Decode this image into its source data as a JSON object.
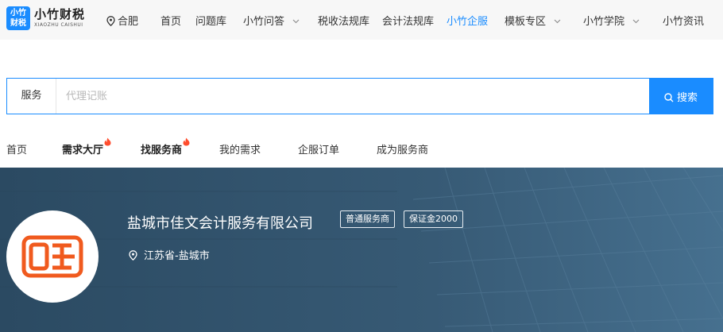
{
  "header": {
    "logo": {
      "mark_line1": "小竹",
      "mark_line2": "财税",
      "name": "小竹财税",
      "sub": "XIAOZHU CAISHUI"
    },
    "location": "合肥",
    "nav": [
      {
        "label": "首页",
        "dropdown": false,
        "active": false
      },
      {
        "label": "问题库",
        "dropdown": false,
        "active": false
      },
      {
        "label": "小竹问答",
        "dropdown": true,
        "active": false
      },
      {
        "label": "税收法规库",
        "dropdown": false,
        "active": false
      },
      {
        "label": "会计法规库",
        "dropdown": false,
        "active": false
      },
      {
        "label": "小竹企服",
        "dropdown": false,
        "active": true
      },
      {
        "label": "模板专区",
        "dropdown": true,
        "active": false
      },
      {
        "label": "小竹学院",
        "dropdown": true,
        "active": false
      },
      {
        "label": "小竹资讯",
        "dropdown": false,
        "active": false
      }
    ]
  },
  "search": {
    "category": "服务",
    "placeholder": "代理记账",
    "button_label": "搜索"
  },
  "subnav": [
    {
      "label": "首页",
      "bold": false,
      "hot": false
    },
    {
      "label": "需求大厅",
      "bold": true,
      "hot": true
    },
    {
      "label": "找服务商",
      "bold": true,
      "hot": true
    },
    {
      "label": "我的需求",
      "bold": false,
      "hot": false
    },
    {
      "label": "企服订单",
      "bold": false,
      "hot": false
    },
    {
      "label": "成为服务商",
      "bold": false,
      "hot": false
    }
  ],
  "provider": {
    "name": "盐城市佳文会计服务有限公司",
    "tags": [
      "普通服务商",
      "保证金2000"
    ],
    "region": "江苏省-盐城市",
    "logo_icon": "jiawen-logo-icon"
  },
  "colors": {
    "accent": "#1a8cff",
    "banner": "#2e4f68",
    "logo_orange": "#f05a1e",
    "hot": "#ff4d2e"
  }
}
